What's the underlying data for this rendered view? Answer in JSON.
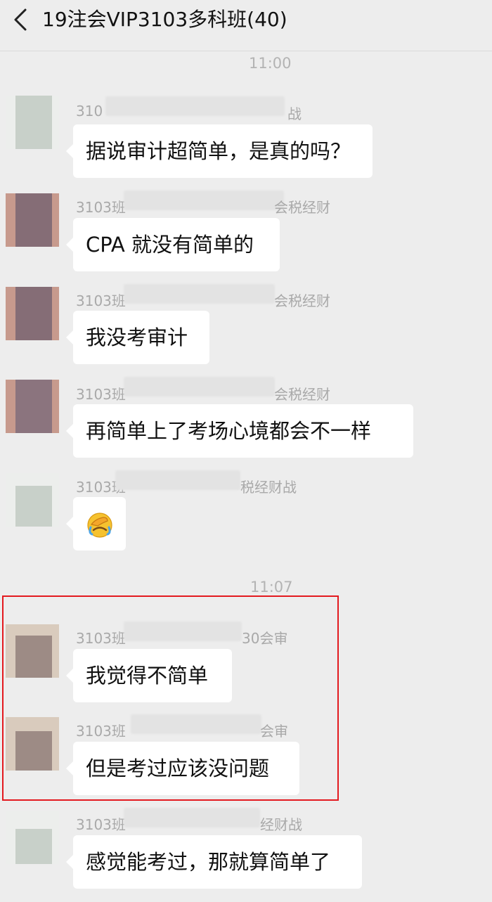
{
  "header": {
    "title": "19注会VIP3103多科班(40)"
  },
  "timestamps": [
    "11:00",
    "11:07"
  ],
  "messages": [
    {
      "sender": "310",
      "sender_tail": "战",
      "text": "据说审计超简单，是真的吗？"
    },
    {
      "sender": "3103班",
      "sender_tail": "会税经财",
      "text": "CPA 就没有简单的"
    },
    {
      "sender": "3103班",
      "sender_tail": "会税经财",
      "text": "我没考审计"
    },
    {
      "sender": "3103班",
      "sender_tail": "会税经财",
      "text": "再简单上了考场心境都会不一样"
    },
    {
      "sender": "3103班",
      "sender_tail": "税经财战",
      "text": ""
    },
    {
      "sender": "3103班",
      "sender_tail": "30会审",
      "text": "我觉得不简单"
    },
    {
      "sender": "3103班",
      "sender_tail": "会审",
      "text": "但是考过应该没问题"
    },
    {
      "sender": "3103班",
      "sender_tail": "经财战",
      "text": "感觉能考过，那就算简单了"
    }
  ],
  "emoji": {
    "name": "facepalm-crying-emoji"
  },
  "icons": {
    "back": "chevron-left-icon"
  },
  "colors": {
    "background": "#ededed",
    "bubble": "#ffffff",
    "highlight": "#e3191f",
    "timestamp": "#b3b3b3"
  }
}
